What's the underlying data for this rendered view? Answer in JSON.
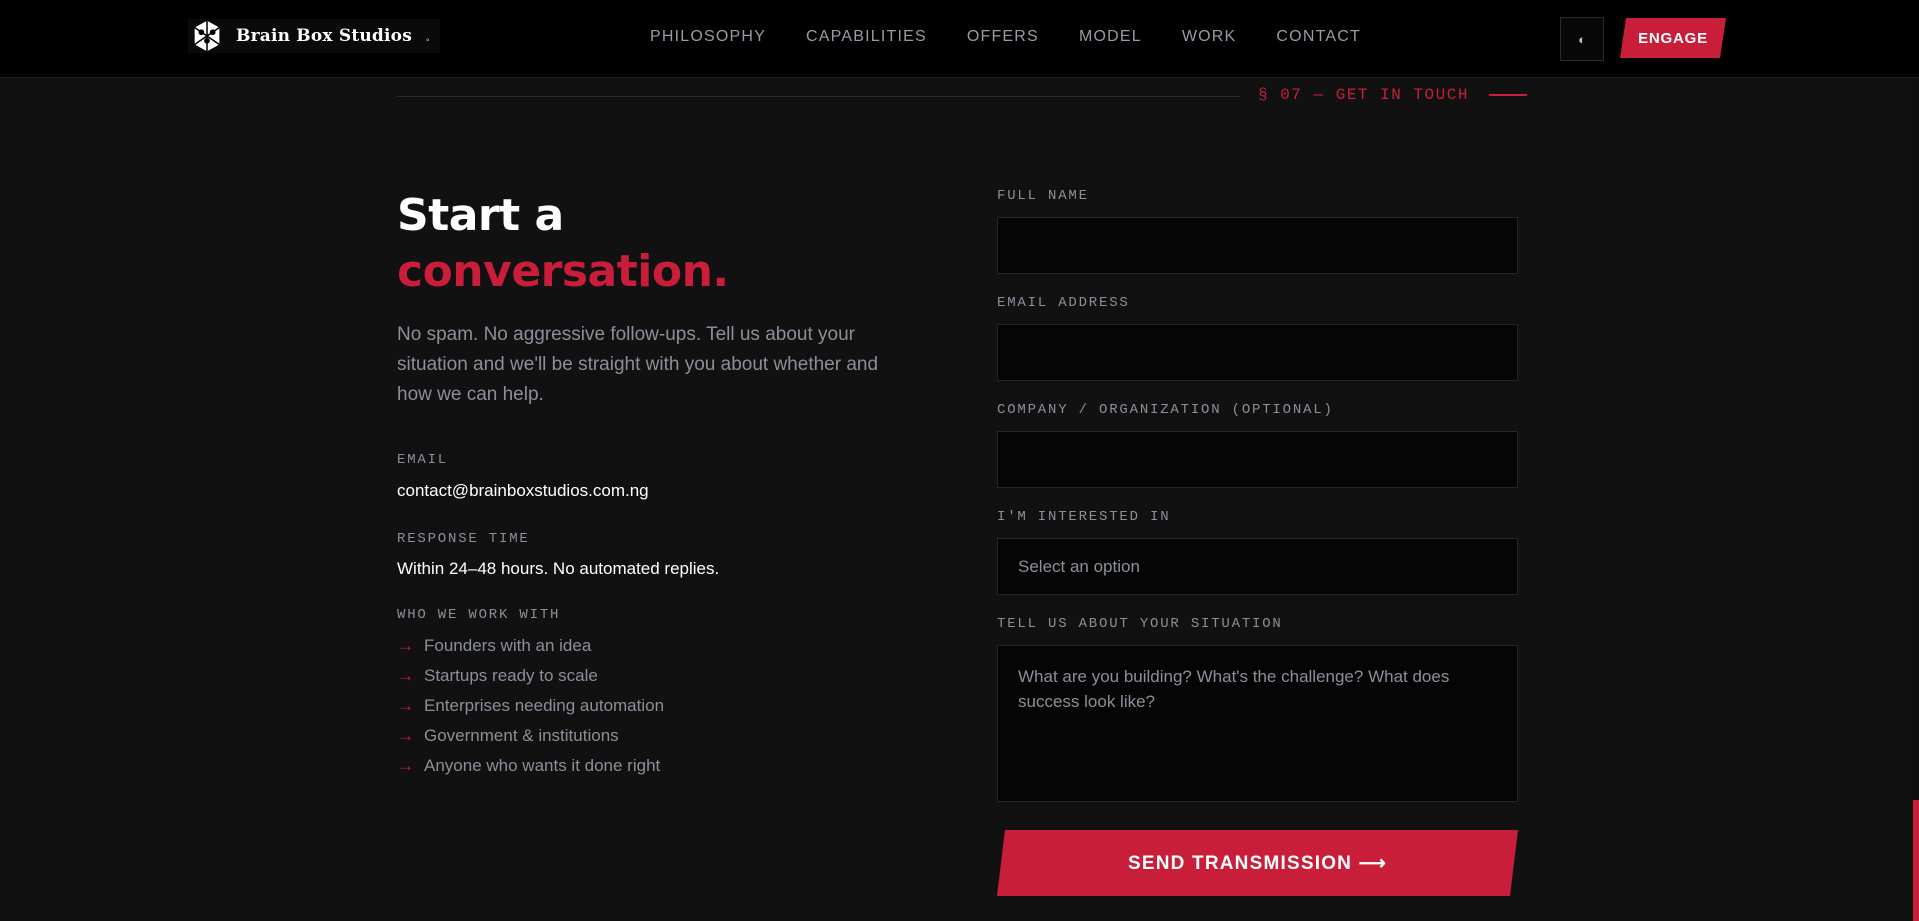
{
  "header": {
    "logo_text": "Brain Box Studios",
    "logo_dot": "◦",
    "nav": [
      "PHILOSOPHY",
      "CAPABILITIES",
      "OFFERS",
      "MODEL",
      "WORK",
      "CONTACT"
    ],
    "theme_toggle_glyph": "◐",
    "engage_label": "ENGAGE"
  },
  "section": {
    "tag": "§ 07 — GET IN TOUCH"
  },
  "left": {
    "heading_line1": "Start a",
    "heading_line2": "conversation.",
    "intro": "No spam. No aggressive follow-ups. Tell us about your situation and we'll be straight with you about whether and how we can help.",
    "email_label": "EMAIL",
    "email_value": "contact@brainboxstudios.com.ng",
    "response_label": "RESPONSE TIME",
    "response_value": "Within 24–48 hours. No automated replies.",
    "who_label": "WHO WE WORK WITH",
    "who_arrow": "→",
    "who_items": [
      "Founders with an idea",
      "Startups ready to scale",
      "Enterprises needing automation",
      "Government & institutions",
      "Anyone who wants it done right"
    ]
  },
  "form": {
    "full_name_label": "FULL NAME",
    "email_label": "EMAIL ADDRESS",
    "company_label": "COMPANY / ORGANIZATION (OPTIONAL)",
    "interest_label": "I'M INTERESTED IN",
    "interest_selected": "Select an option",
    "situation_label": "TELL US ABOUT YOUR SITUATION",
    "situation_placeholder": "What are you building? What's the challenge? What does success look like?",
    "submit_label": "SEND TRANSMISSION ⟶"
  },
  "colors": {
    "accent": "#c81e3a",
    "background": "#111111",
    "header_bg": "#000000"
  }
}
